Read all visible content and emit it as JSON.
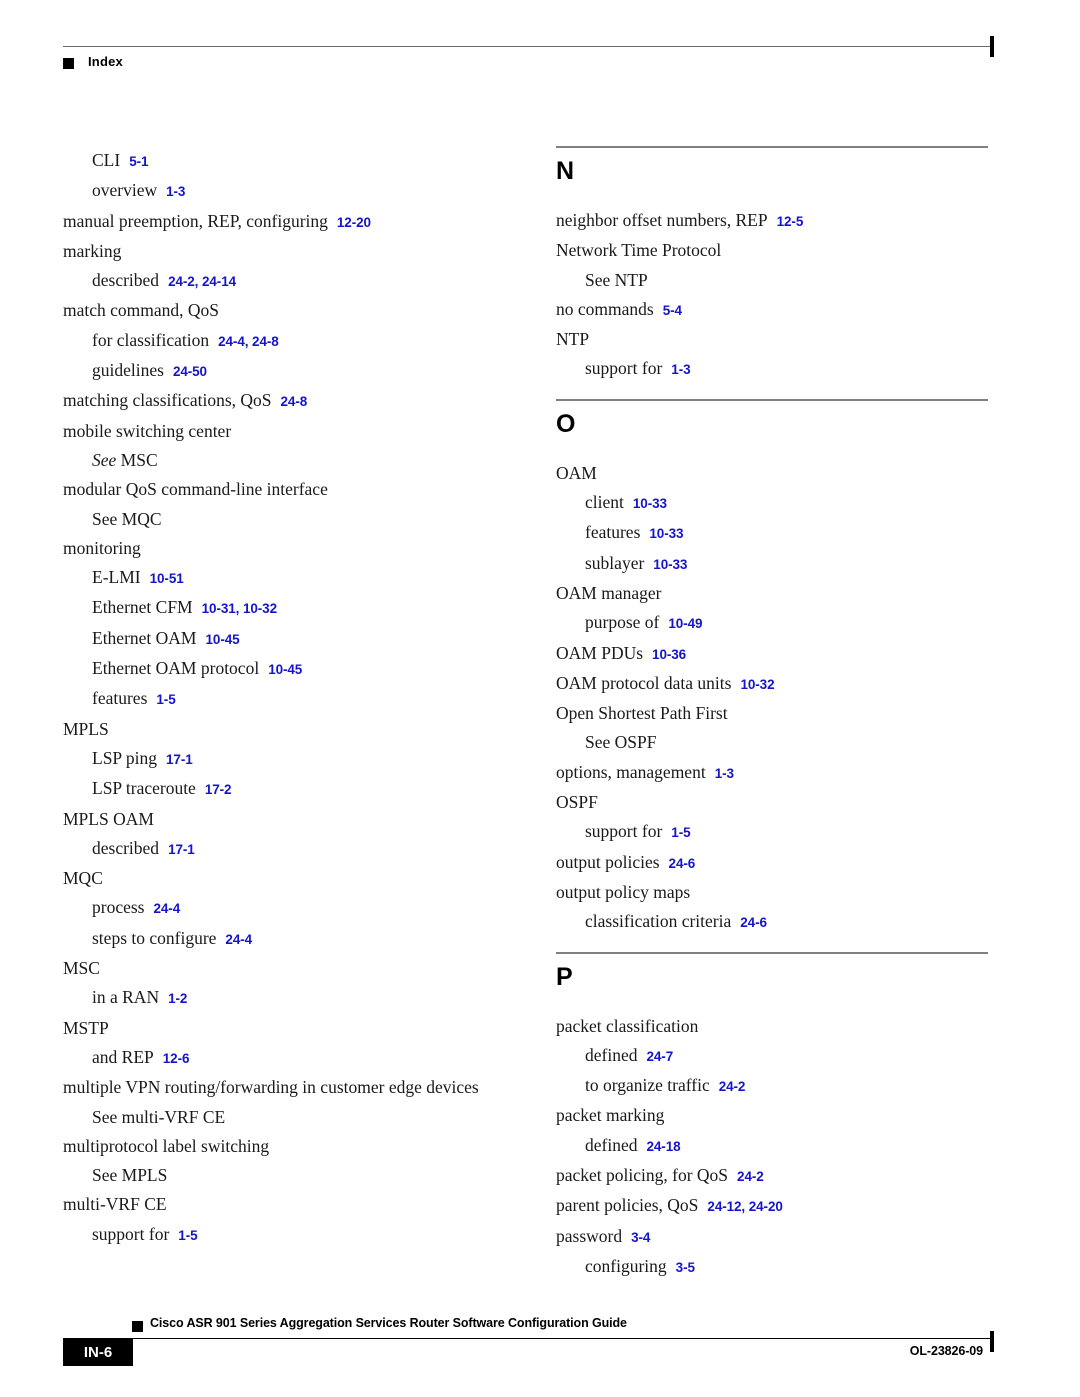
{
  "header": {
    "title": "Index",
    "marker_icon": "square-bullet-icon"
  },
  "footer": {
    "guide_title": "Cisco ASR 901 Series Aggregation Services Router Software Configuration Guide",
    "page_number": "IN-6",
    "doc_id": "OL-23826-09",
    "marker_icon": "square-bullet-icon"
  },
  "colors": {
    "locator_blue": "#1414CC",
    "section_rule_gray": "#808080",
    "header_rule_gray": "#6A6A6A",
    "text_black": "#000000"
  },
  "columns": {
    "left": {
      "sections": [
        {
          "letter": null,
          "show_rule": false,
          "entries": [
            {
              "level": 1,
              "text": "CLI",
              "locator": "5-1"
            },
            {
              "level": 1,
              "text": "overview",
              "locator": "1-3"
            },
            {
              "level": 0,
              "text": "manual preemption, REP, configuring",
              "locator": "12-20"
            },
            {
              "level": 0,
              "text": "marking",
              "locator": null
            },
            {
              "level": 1,
              "text": "described",
              "locator": "24-2, 24-14"
            },
            {
              "level": 0,
              "text": "match command, QoS",
              "locator": null
            },
            {
              "level": 1,
              "text": "for classification",
              "locator": "24-4, 24-8"
            },
            {
              "level": 1,
              "text": "guidelines",
              "locator": "24-50"
            },
            {
              "level": 0,
              "text": "matching classifications, QoS",
              "locator": "24-8"
            },
            {
              "level": 0,
              "text": "mobile switching center",
              "locator": null
            },
            {
              "level": 1,
              "text": "See MSC",
              "locator": null,
              "see_italic": "See"
            },
            {
              "level": 0,
              "text": "modular QoS command-line interface",
              "locator": null
            },
            {
              "level": 1,
              "text": "See MQC",
              "locator": null
            },
            {
              "level": 0,
              "text": "monitoring",
              "locator": null
            },
            {
              "level": 1,
              "text": "E-LMI",
              "locator": "10-51"
            },
            {
              "level": 1,
              "text": "Ethernet CFM",
              "locator": "10-31, 10-32"
            },
            {
              "level": 1,
              "text": "Ethernet OAM",
              "locator": "10-45"
            },
            {
              "level": 1,
              "text": "Ethernet OAM protocol",
              "locator": "10-45"
            },
            {
              "level": 1,
              "text": "features",
              "locator": "1-5"
            },
            {
              "level": 0,
              "text": "MPLS",
              "locator": null
            },
            {
              "level": 1,
              "text": "LSP ping",
              "locator": "17-1"
            },
            {
              "level": 1,
              "text": "LSP traceroute",
              "locator": "17-2"
            },
            {
              "level": 0,
              "text": "MPLS OAM",
              "locator": null
            },
            {
              "level": 1,
              "text": "described",
              "locator": "17-1"
            },
            {
              "level": 0,
              "text": "MQC",
              "locator": null
            },
            {
              "level": 1,
              "text": "process",
              "locator": "24-4"
            },
            {
              "level": 1,
              "text": "steps to configure",
              "locator": "24-4"
            },
            {
              "level": 0,
              "text": "MSC",
              "locator": null
            },
            {
              "level": 1,
              "text": "in a RAN",
              "locator": "1-2"
            },
            {
              "level": 0,
              "text": "MSTP",
              "locator": null
            },
            {
              "level": 1,
              "text": "and REP",
              "locator": "12-6"
            },
            {
              "level": 0,
              "text": "multiple VPN routing/forwarding in customer edge devices",
              "locator": null
            },
            {
              "level": 1,
              "text": "See multi-VRF CE",
              "locator": null
            },
            {
              "level": 0,
              "text": "multiprotocol label switching",
              "locator": null
            },
            {
              "level": 1,
              "text": "See MPLS",
              "locator": null
            },
            {
              "level": 0,
              "text": "multi-VRF CE",
              "locator": null
            },
            {
              "level": 1,
              "text": "support for",
              "locator": "1-5"
            }
          ]
        }
      ]
    },
    "right": {
      "sections": [
        {
          "letter": "N",
          "show_rule": true,
          "entries": [
            {
              "level": 0,
              "text": "neighbor offset numbers, REP",
              "locator": "12-5"
            },
            {
              "level": 0,
              "text": "Network Time Protocol",
              "locator": null
            },
            {
              "level": 1,
              "text": "See NTP",
              "locator": null
            },
            {
              "level": 0,
              "text": "no commands",
              "locator": "5-4"
            },
            {
              "level": 0,
              "text": "NTP",
              "locator": null
            },
            {
              "level": 1,
              "text": "support for",
              "locator": "1-3"
            }
          ]
        },
        {
          "letter": "O",
          "show_rule": true,
          "entries": [
            {
              "level": 0,
              "text": "OAM",
              "locator": null
            },
            {
              "level": 1,
              "text": "client",
              "locator": "10-33"
            },
            {
              "level": 1,
              "text": "features",
              "locator": "10-33"
            },
            {
              "level": 1,
              "text": "sublayer",
              "locator": "10-33"
            },
            {
              "level": 0,
              "text": "OAM manager",
              "locator": null
            },
            {
              "level": 1,
              "text": "purpose of",
              "locator": "10-49"
            },
            {
              "level": 0,
              "text": "OAM PDUs",
              "locator": "10-36"
            },
            {
              "level": 0,
              "text": "OAM protocol data units",
              "locator": "10-32"
            },
            {
              "level": 0,
              "text": "Open Shortest Path First",
              "locator": null
            },
            {
              "level": 1,
              "text": "See OSPF",
              "locator": null
            },
            {
              "level": 0,
              "text": "options, management",
              "locator": "1-3"
            },
            {
              "level": 0,
              "text": "OSPF",
              "locator": null
            },
            {
              "level": 1,
              "text": "support for",
              "locator": "1-5"
            },
            {
              "level": 0,
              "text": "output policies",
              "locator": "24-6"
            },
            {
              "level": 0,
              "text": "output policy maps",
              "locator": null
            },
            {
              "level": 1,
              "text": "classification criteria",
              "locator": "24-6"
            }
          ]
        },
        {
          "letter": "P",
          "show_rule": true,
          "entries": [
            {
              "level": 0,
              "text": "packet classification",
              "locator": null
            },
            {
              "level": 1,
              "text": "defined",
              "locator": "24-7"
            },
            {
              "level": 1,
              "text": "to organize traffic",
              "locator": "24-2"
            },
            {
              "level": 0,
              "text": "packet marking",
              "locator": null
            },
            {
              "level": 1,
              "text": "defined",
              "locator": "24-18"
            },
            {
              "level": 0,
              "text": "packet policing, for QoS",
              "locator": "24-2"
            },
            {
              "level": 0,
              "text": "parent policies, QoS",
              "locator": "24-12, 24-20"
            },
            {
              "level": 0,
              "text": "password",
              "locator": "3-4"
            },
            {
              "level": 1,
              "text": "configuring",
              "locator": "3-5"
            }
          ]
        }
      ]
    }
  }
}
